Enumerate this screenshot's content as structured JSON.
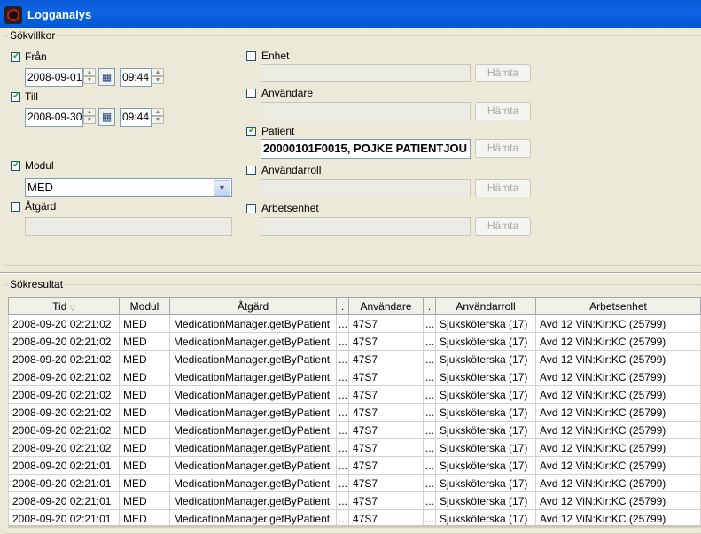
{
  "window": {
    "title": "Logganalys"
  },
  "criteria": {
    "legend": "Sökvillkor",
    "from": {
      "label": "Från",
      "checked": true,
      "date": "2008-09-01",
      "time": "09:44"
    },
    "to": {
      "label": "Till",
      "checked": true,
      "date": "2008-09-30",
      "time": "09:44"
    },
    "module": {
      "label": "Modul",
      "checked": true,
      "value": "MED"
    },
    "action": {
      "label": "Åtgärd",
      "checked": false,
      "value": ""
    },
    "unit": {
      "label": "Enhet",
      "checked": false,
      "value": "",
      "fetch_label": "Hämta"
    },
    "user": {
      "label": "Användare",
      "checked": false,
      "value": "",
      "fetch_label": "Hämta"
    },
    "patient": {
      "label": "Patient",
      "checked": true,
      "value": "20000101F0015, POJKE PATIENTJOU",
      "fetch_label": "Hämta"
    },
    "user_role": {
      "label": "Användarroll",
      "checked": false,
      "value": "",
      "fetch_label": "Hämta"
    },
    "work_unit": {
      "label": "Arbetsenhet",
      "checked": false,
      "value": "",
      "fetch_label": "Hämta"
    }
  },
  "results": {
    "legend": "Sökresultat",
    "columns": [
      "Tid",
      "Modul",
      "Åtgärd",
      ".",
      "Användare",
      ".",
      "Användarroll",
      "Arbetsenhet"
    ],
    "rows": [
      [
        "2008-09-20 02:21:02",
        "MED",
        "MedicationManager.getByPatient",
        "...",
        "47S7",
        "...",
        "Sjuksköterska (17)",
        "Avd 12 ViN:Kir:KC (25799)"
      ],
      [
        "2008-09-20 02:21:02",
        "MED",
        "MedicationManager.getByPatient",
        "...",
        "47S7",
        "...",
        "Sjuksköterska (17)",
        "Avd 12 ViN:Kir:KC (25799)"
      ],
      [
        "2008-09-20 02:21:02",
        "MED",
        "MedicationManager.getByPatient",
        "...",
        "47S7",
        "...",
        "Sjuksköterska (17)",
        "Avd 12 ViN:Kir:KC (25799)"
      ],
      [
        "2008-09-20 02:21:02",
        "MED",
        "MedicationManager.getByPatient",
        "...",
        "47S7",
        "...",
        "Sjuksköterska (17)",
        "Avd 12 ViN:Kir:KC (25799)"
      ],
      [
        "2008-09-20 02:21:02",
        "MED",
        "MedicationManager.getByPatient",
        "...",
        "47S7",
        "...",
        "Sjuksköterska (17)",
        "Avd 12 ViN:Kir:KC (25799)"
      ],
      [
        "2008-09-20 02:21:02",
        "MED",
        "MedicationManager.getByPatient",
        "...",
        "47S7",
        "...",
        "Sjuksköterska (17)",
        "Avd 12 ViN:Kir:KC (25799)"
      ],
      [
        "2008-09-20 02:21:02",
        "MED",
        "MedicationManager.getByPatient",
        "...",
        "47S7",
        "...",
        "Sjuksköterska (17)",
        "Avd 12 ViN:Kir:KC (25799)"
      ],
      [
        "2008-09-20 02:21:02",
        "MED",
        "MedicationManager.getByPatient",
        "...",
        "47S7",
        "...",
        "Sjuksköterska (17)",
        "Avd 12 ViN:Kir:KC (25799)"
      ],
      [
        "2008-09-20 02:21:01",
        "MED",
        "MedicationManager.getByPatient",
        "...",
        "47S7",
        "...",
        "Sjuksköterska (17)",
        "Avd 12 ViN:Kir:KC (25799)"
      ],
      [
        "2008-09-20 02:21:01",
        "MED",
        "MedicationManager.getByPatient",
        "...",
        "47S7",
        "...",
        "Sjuksköterska (17)",
        "Avd 12 ViN:Kir:KC (25799)"
      ],
      [
        "2008-09-20 02:21:01",
        "MED",
        "MedicationManager.getByPatient",
        "...",
        "47S7",
        "...",
        "Sjuksköterska (17)",
        "Avd 12 ViN:Kir:KC (25799)"
      ],
      [
        "2008-09-20 02:21:01",
        "MED",
        "MedicationManager.getByPatient",
        "...",
        "47S7",
        "...",
        "Sjuksköterska (17)",
        "Avd 12 ViN:Kir:KC (25799)"
      ]
    ]
  }
}
